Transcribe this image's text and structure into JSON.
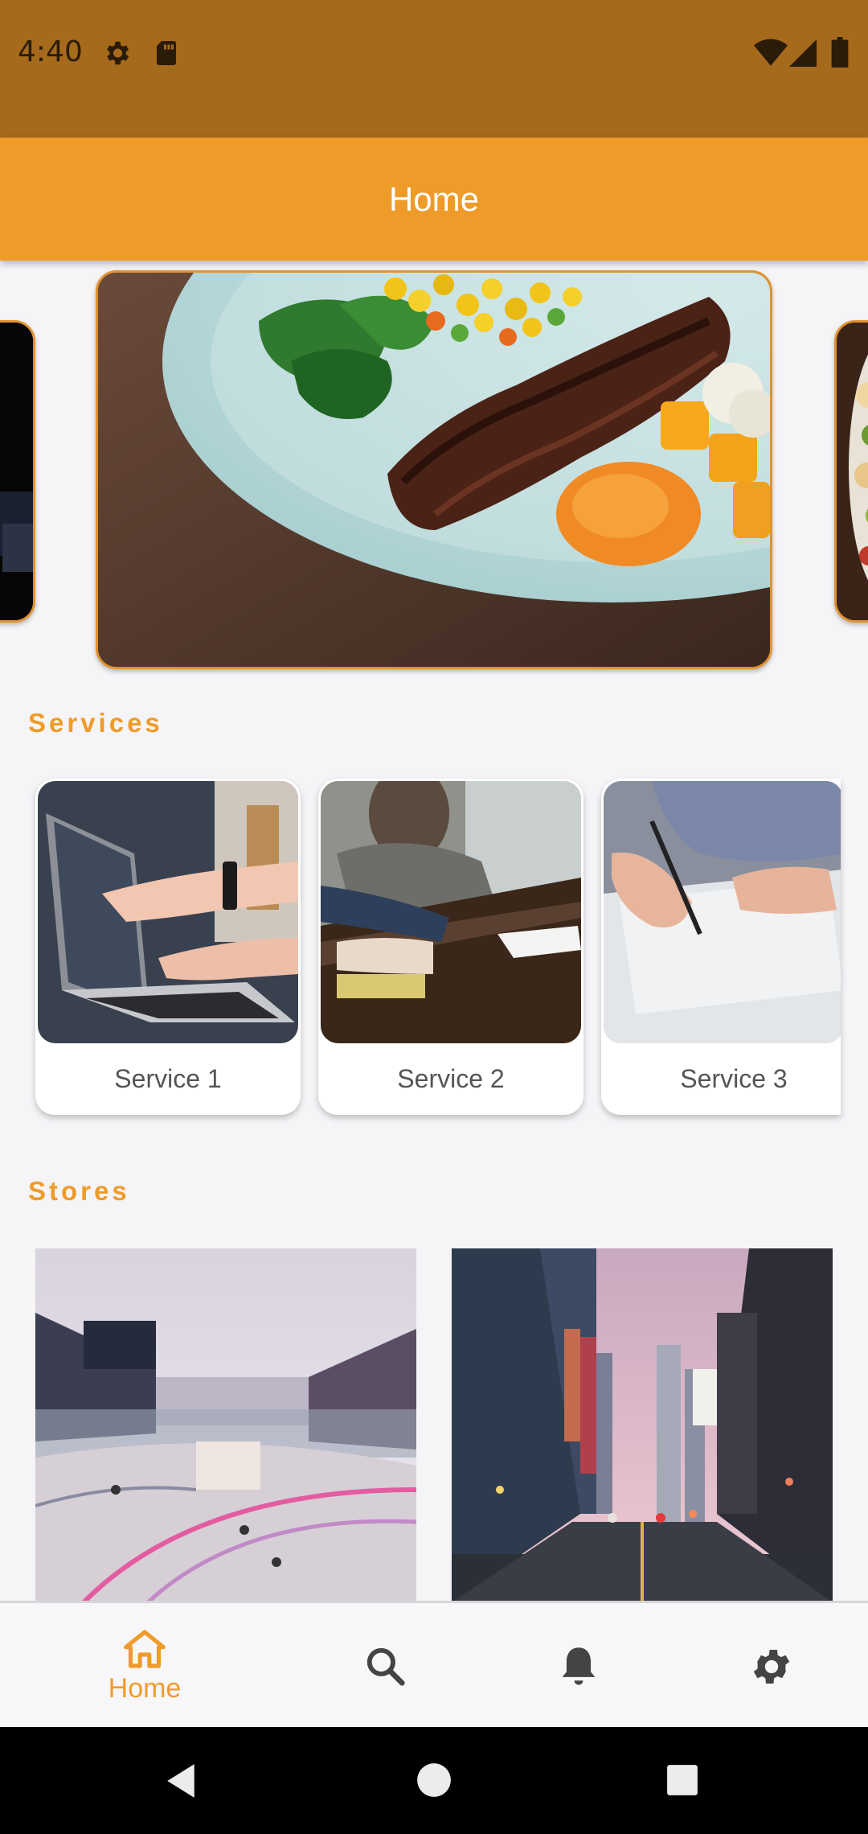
{
  "status_bar": {
    "time": "4:40",
    "icons": [
      "gear-icon",
      "sd-card-icon",
      "wifi-icon",
      "signal-icon",
      "battery-icon"
    ],
    "color": "#a56a1b"
  },
  "app_bar": {
    "title": "Home",
    "color": "#ef9b2a"
  },
  "carousel": {
    "items": [
      {
        "image": "dark-food-photo"
      },
      {
        "image": "steak-plate-photo"
      },
      {
        "image": "salad-photo"
      }
    ]
  },
  "services": {
    "heading": "Services",
    "items": [
      {
        "label": "Service 1",
        "image": "laptop-pointing-photo"
      },
      {
        "label": "Service 2",
        "image": "meeting-table-photo"
      },
      {
        "label": "Service 3",
        "image": "writing-document-photo"
      }
    ]
  },
  "stores": {
    "heading": "Stores",
    "items": [
      {
        "image": "shopping-mall-photo"
      },
      {
        "image": "city-street-photo"
      }
    ]
  },
  "bottom_nav": {
    "items": [
      {
        "label": "Home",
        "icon": "home-icon",
        "active": true
      },
      {
        "label": "",
        "icon": "search-icon",
        "active": false
      },
      {
        "label": "",
        "icon": "bell-icon",
        "active": false
      },
      {
        "label": "",
        "icon": "gear-icon",
        "active": false
      }
    ],
    "active_color": "#ef9b2a",
    "inactive_color": "#444444"
  },
  "system_nav": {
    "buttons": [
      "back-icon",
      "home-circle-icon",
      "recents-icon"
    ]
  }
}
